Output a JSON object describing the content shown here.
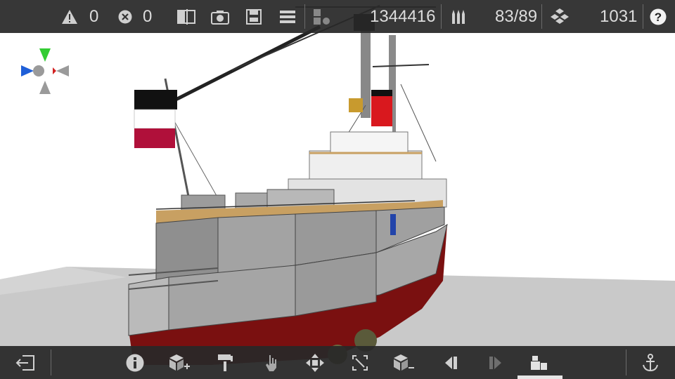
{
  "topbar": {
    "warnings_count": "0",
    "errors_count": "0",
    "polygon_count": "1344416",
    "ammo_count": "83/89",
    "parts_count": "1031",
    "icons": [
      "warning-icon",
      "error-icon",
      "split-view-icon",
      "camera-icon",
      "save-icon",
      "menu-icon",
      "polygon-icon",
      "ammo-icon",
      "parts-icon",
      "help-icon"
    ]
  },
  "bottombar": {
    "icons": [
      "exit-icon",
      "info-icon",
      "add-part-icon",
      "paint-icon",
      "hand-icon",
      "move-icon",
      "resize-icon",
      "remove-part-icon",
      "previous-icon",
      "next-icon",
      "assembly-icon",
      "anchor-icon"
    ],
    "active_tool": "assembly-icon"
  },
  "gizmo": {
    "up_color": "#33cc33",
    "left_color": "#1f5fd8",
    "right_color": "#d22222",
    "neutral_color": "#9a9a9a"
  },
  "scene": {
    "hull_red": "#7a1010",
    "hull_grey": "#9c9c9c",
    "deck_wood": "#c8a062"
  },
  "flag": {
    "stripe_colors": [
      "#111111",
      "#ffffff",
      "#b0103a"
    ]
  }
}
